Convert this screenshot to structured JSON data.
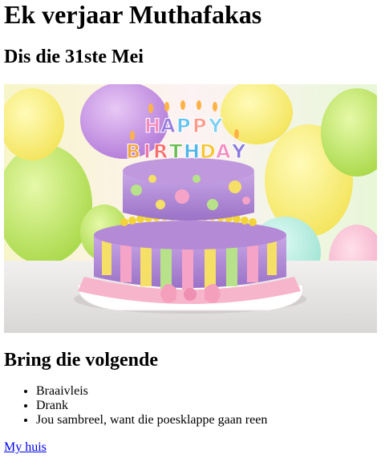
{
  "heading": "Ek verjaar Muthafakas",
  "subheading": "Dis die 31ste Mei",
  "image": {
    "alt": "Happy Birthday cake",
    "cake_letters": [
      "H",
      "A",
      "P",
      "P",
      "Y",
      "B",
      "I",
      "R",
      "T",
      "H",
      "D",
      "A",
      "Y"
    ]
  },
  "list_heading": "Bring die volgende",
  "items": [
    "Braaivleis",
    "Drank",
    "Jou sambreel, want die poesklappe gaan reen"
  ],
  "link": {
    "label": "My huis",
    "color": "#0000ee"
  }
}
